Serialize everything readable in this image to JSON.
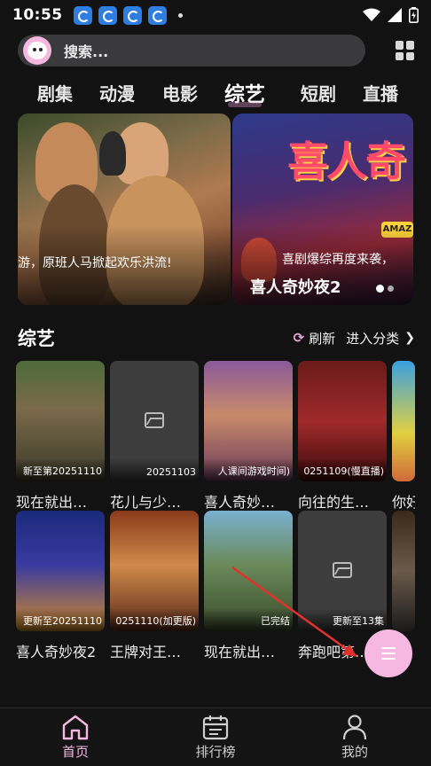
{
  "status": {
    "time": "10:55"
  },
  "search": {
    "placeholder": "搜索..."
  },
  "tabs": [
    "剧集",
    "动漫",
    "电影",
    "综艺",
    "短剧",
    "直播"
  ],
  "active_tab": "综艺",
  "banners": [
    {
      "caption": "游，原班人马掀起欢乐洪流!",
      "title": ""
    },
    {
      "caption": "喜剧爆综再度来袭，",
      "title": "喜人奇妙夜2",
      "logo": "喜人奇",
      "badge": "AMAZ"
    }
  ],
  "section": {
    "title": "综艺",
    "refresh_label": "刷新",
    "more_label": "进入分类"
  },
  "row1": [
    {
      "tag": "新至第20251110",
      "name": "现在就出…"
    },
    {
      "tag": "20251103",
      "name": "花儿与少…"
    },
    {
      "tag": "人课间游戏时间)",
      "name": "喜人奇妙…"
    },
    {
      "tag": "0251109(慢直播)",
      "name": "向往的生…"
    },
    {
      "tag": "",
      "name": "你好"
    }
  ],
  "row2": [
    {
      "tag": "更新至20251110",
      "name": "喜人奇妙夜2"
    },
    {
      "tag": "0251110(加更版)",
      "name": "王牌对王…"
    },
    {
      "tag": "已完结",
      "name": "现在就出…"
    },
    {
      "tag": "更新至13集",
      "name": "奔跑吧第…"
    },
    {
      "tag": "",
      "name": ""
    }
  ],
  "nav": [
    {
      "label": "首页"
    },
    {
      "label": "排行榜"
    },
    {
      "label": "我的"
    }
  ],
  "colors": {
    "accent": "#f6b8e0",
    "background": "#121212"
  }
}
